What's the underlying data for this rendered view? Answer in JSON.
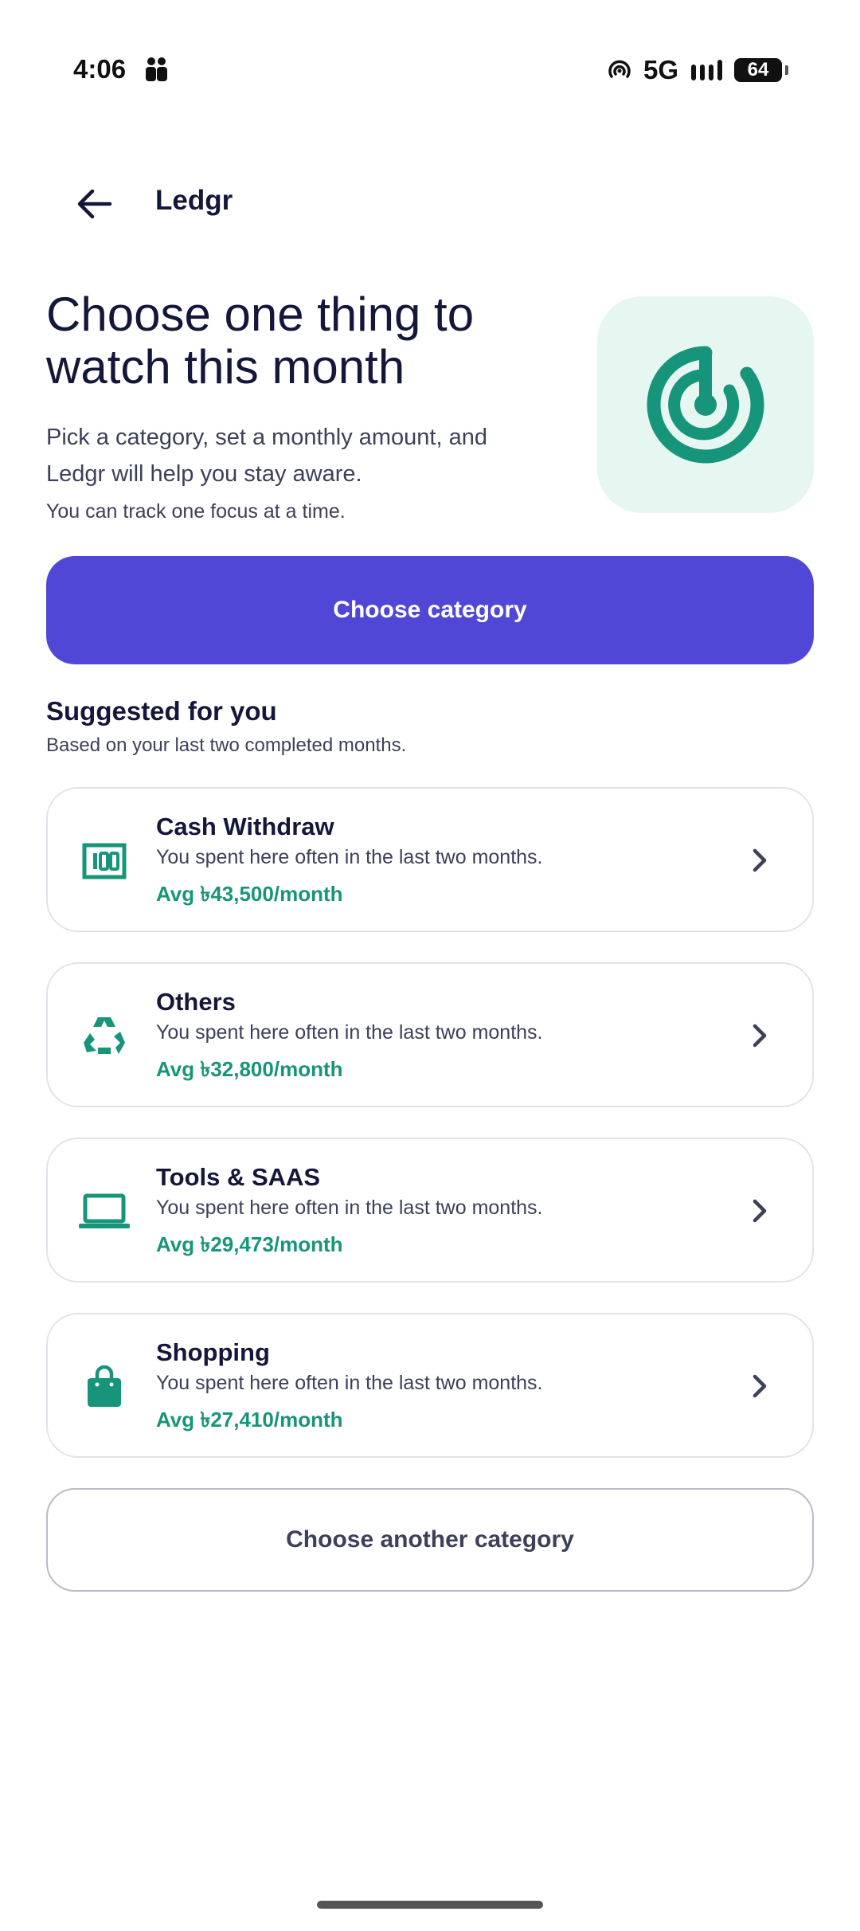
{
  "status_bar": {
    "time": "4:06",
    "network": "5G",
    "battery": "64"
  },
  "app_bar": {
    "title": "Ledgr"
  },
  "hero": {
    "title": "Choose one thing to watch this month",
    "subtitle": "Pick a category, set a monthly amount, and Ledgr will help you stay aware.",
    "note": "You can track one focus at a time.",
    "icon": "focus-target-icon"
  },
  "primary_button": {
    "label": "Choose category"
  },
  "suggestions": {
    "title": "Suggested for you",
    "subtitle": "Based on your last two completed months.",
    "items": [
      {
        "name": "Cash Withdraw",
        "description": "You spent here often in the last two months.",
        "average": "Avg ৳43,500/month",
        "icon": "cash-icon"
      },
      {
        "name": "Others",
        "description": "You spent here often in the last two months.",
        "average": "Avg ৳32,800/month",
        "icon": "recycle-icon"
      },
      {
        "name": "Tools & SAAS",
        "description": "You spent here often in the last two months.",
        "average": "Avg ৳29,473/month",
        "icon": "laptop-icon"
      },
      {
        "name": "Shopping",
        "description": "You spent here often in the last two months.",
        "average": "Avg ৳27,410/month",
        "icon": "shopping-bag-icon"
      }
    ]
  },
  "secondary_button": {
    "label": "Choose another category"
  },
  "colors": {
    "primary": "#5147d6",
    "accent_green": "#17957a",
    "hero_bg": "#e6f6f1",
    "text_dark": "#14163a"
  }
}
